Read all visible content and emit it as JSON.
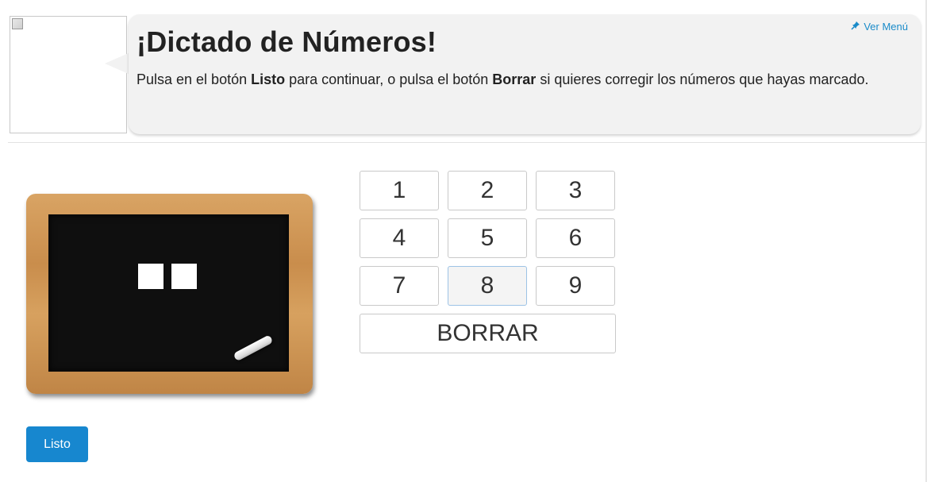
{
  "header": {
    "title": "¡Dictado de Números!",
    "instruction_1": "Pulsa en el botón ",
    "instruction_listo": "Listo",
    "instruction_2": " para continuar, o pulsa el botón ",
    "instruction_borrar": "Borrar",
    "instruction_3": " si quieres corregir los números que hayas marcado.",
    "menu_link": "Ver Menú",
    "menu_icon": "pin-icon"
  },
  "board": {
    "slots_filled": 0,
    "slots_total": 2
  },
  "keypad": {
    "keys": [
      "1",
      "2",
      "3",
      "4",
      "5",
      "6",
      "7",
      "8",
      "9"
    ],
    "active_key": "8",
    "clear_label": "BORRAR"
  },
  "actions": {
    "done_label": "Listo",
    "accent_color": "#1787cf"
  }
}
